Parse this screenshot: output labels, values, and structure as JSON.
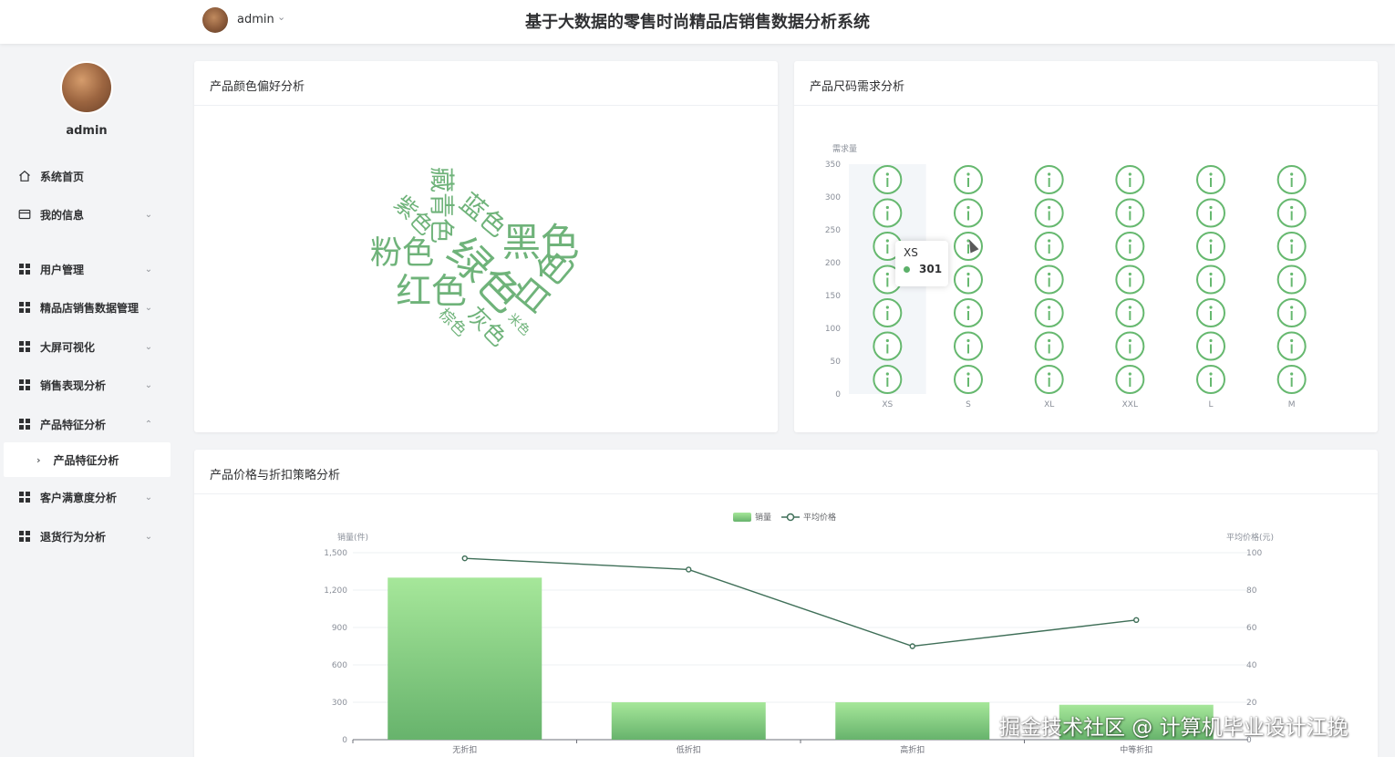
{
  "header": {
    "user_name": "admin",
    "app_title": "基于大数据的零售时尚精品店销售数据分析系统"
  },
  "sidebar": {
    "user_name": "admin",
    "items": [
      {
        "label": "系统首页",
        "icon": "home-icon",
        "caret": ""
      },
      {
        "label": "我的信息",
        "icon": "card-icon",
        "caret": "⌄"
      },
      {
        "label": "用户管理",
        "icon": "grid-icon",
        "caret": "⌄"
      },
      {
        "label": "精品店销售数据管理",
        "icon": "grid-icon",
        "caret": "⌄"
      },
      {
        "label": "大屏可视化",
        "icon": "grid-icon",
        "caret": "⌄"
      },
      {
        "label": "销售表现分析",
        "icon": "grid-icon",
        "caret": "⌄"
      },
      {
        "label": "产品特征分析",
        "icon": "grid-icon",
        "caret": "⌃"
      },
      {
        "label": "客户满意度分析",
        "icon": "grid-icon",
        "caret": "⌄"
      },
      {
        "label": "退货行为分析",
        "icon": "grid-icon",
        "caret": "⌄"
      }
    ],
    "active_sub": {
      "label": "产品特征分析",
      "arrow": "›"
    }
  },
  "cards": {
    "color": {
      "title": "产品颜色偏好分析"
    },
    "size": {
      "title": "产品尺码需求分析"
    },
    "price": {
      "title": "产品价格与折扣策略分析"
    }
  },
  "tooltip": {
    "label": "XS",
    "value": "301"
  },
  "watermark": "掘金技术社区 @ 计算机毕业设计江挽",
  "colors": {
    "accent": "#5cb06a",
    "bar_top": "#a6e79a",
    "bar_bottom": "#67b36c",
    "line": "#3f6f58",
    "word": "#6fb37a"
  },
  "chart_data": [
    {
      "type": "wordcloud",
      "title": "产品颜色偏好分析",
      "words": [
        {
          "text": "绿色",
          "weight": 10
        },
        {
          "text": "黑色",
          "weight": 9
        },
        {
          "text": "白色",
          "weight": 8
        },
        {
          "text": "红色",
          "weight": 8
        },
        {
          "text": "粉色",
          "weight": 7
        },
        {
          "text": "蓝色",
          "weight": 5
        },
        {
          "text": "藏青色",
          "weight": 5
        },
        {
          "text": "紫色",
          "weight": 4
        },
        {
          "text": "灰色",
          "weight": 4
        },
        {
          "text": "棕色",
          "weight": 2
        },
        {
          "text": "米色",
          "weight": 1
        }
      ]
    },
    {
      "type": "pictorial_bar",
      "title": "产品尺码需求分析",
      "ylabel": "需求量",
      "ylim": [
        0,
        350
      ],
      "yticks": [
        0,
        50,
        100,
        150,
        200,
        250,
        300,
        350
      ],
      "categories": [
        "XS",
        "S",
        "XL",
        "XXL",
        "L",
        "M"
      ],
      "values": [
        301,
        335,
        335,
        335,
        335,
        335
      ],
      "symbol_icon": "info-icon",
      "highlight": "XS"
    },
    {
      "type": "bar_line",
      "title": "产品价格与折扣策略分析",
      "categories": [
        "无折扣",
        "低折扣",
        "高折扣",
        "中等折扣"
      ],
      "ylabel_left": "销量(件)",
      "ylabel_right": "平均价格(元)",
      "ylim_left": [
        0,
        1500
      ],
      "ylim_right": [
        0,
        100
      ],
      "yticks_left": [
        "0",
        "300",
        "600",
        "900",
        "1,200",
        "1,500"
      ],
      "yticks_right": [
        "0",
        "20",
        "40",
        "60",
        "80",
        "100"
      ],
      "legend": [
        "销量",
        "平均价格"
      ],
      "series": [
        {
          "name": "销量",
          "type": "bar",
          "values": [
            1300,
            300,
            300,
            280
          ]
        },
        {
          "name": "平均价格",
          "type": "line",
          "values": [
            97,
            91,
            50,
            64
          ]
        }
      ]
    }
  ]
}
